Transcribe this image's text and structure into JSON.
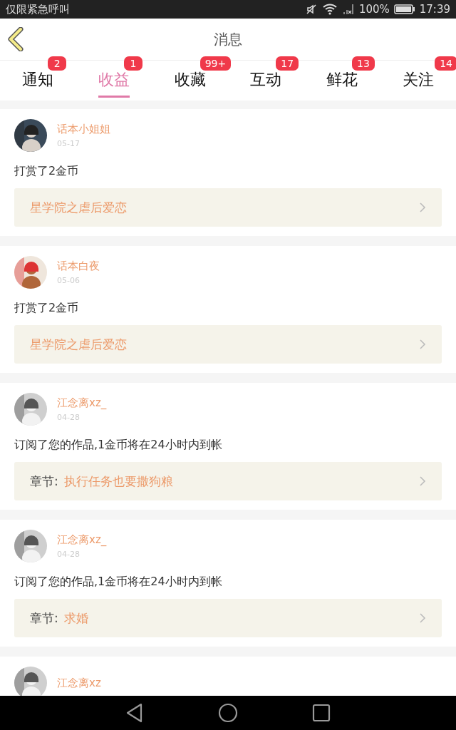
{
  "status_bar": {
    "carrier": "仅限紧急呼叫",
    "battery": "100%",
    "time": "17:39"
  },
  "header": {
    "title": "消息"
  },
  "tabs": [
    {
      "label": "通知",
      "badge": "2",
      "selected": false
    },
    {
      "label": "收益",
      "badge": "1",
      "selected": true
    },
    {
      "label": "收藏",
      "badge": "99+",
      "selected": false
    },
    {
      "label": "互动",
      "badge": "17",
      "selected": false
    },
    {
      "label": "鲜花",
      "badge": "13",
      "selected": false
    },
    {
      "label": "关注",
      "badge": "14",
      "selected": false
    }
  ],
  "messages": [
    {
      "user": "话本小姐姐",
      "date": "05-17",
      "text": "打赏了2金币",
      "link": {
        "title": "星学院之虐后爱恋"
      }
    },
    {
      "user": "话本白夜",
      "date": "05-06",
      "text": "打赏了2金币",
      "link": {
        "title": "星学院之虐后爱恋"
      }
    },
    {
      "user": "江念离xz_",
      "date": "04-28",
      "text": "订阅了您的作品,1金币将在24小时内到帐",
      "link": {
        "label": "章节:",
        "title": "执行任务也要撒狗粮"
      }
    },
    {
      "user": "江念离xz_",
      "date": "04-28",
      "text": "订阅了您的作品,1金币将在24小时内到帐",
      "link": {
        "label": "章节:",
        "title": "求婚"
      }
    },
    {
      "user": "江念离xz"
    }
  ]
}
